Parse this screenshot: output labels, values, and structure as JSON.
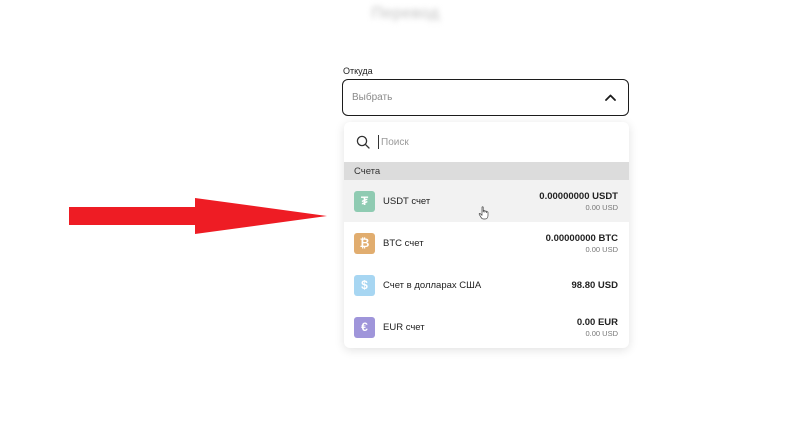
{
  "page": {
    "title": "Перевод"
  },
  "from_field": {
    "label": "Откуда",
    "placeholder": "Выбрать"
  },
  "dropdown": {
    "search_placeholder": "Поиск",
    "section_title": "Счета",
    "accounts": [
      {
        "name": "USDT счет",
        "amount": "0.00000000 USDT",
        "usd": "0.00 USD",
        "icon": "tether-icon",
        "color": "#8fcbb2",
        "glyph": "₮"
      },
      {
        "name": "BTC счет",
        "amount": "0.00000000 BTC",
        "usd": "0.00 USD",
        "icon": "bitcoin-icon",
        "color": "#e1ad6f",
        "glyph": "₿"
      },
      {
        "name": "Счет в долларах США",
        "amount": "98.80 USD",
        "usd": "",
        "icon": "dollar-icon",
        "color": "#a7d6f2",
        "glyph": "$"
      },
      {
        "name": "EUR счет",
        "amount": "0.00 EUR",
        "usd": "0.00 USD",
        "icon": "euro-icon",
        "color": "#9f95da",
        "glyph": "€"
      }
    ]
  },
  "colors": {
    "arrow": "#ee1c24",
    "hover_row": "#f2f2f2",
    "section_bg": "#dcdcdc"
  }
}
